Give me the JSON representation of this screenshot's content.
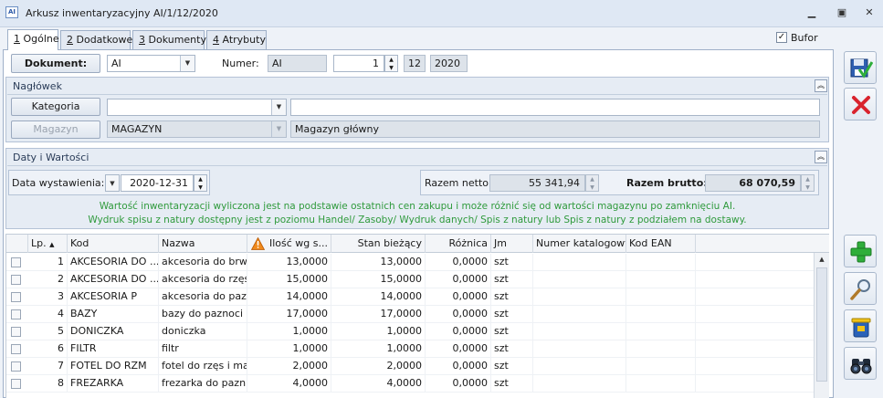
{
  "window": {
    "title": "Arkusz inwentaryzacyjny AI/1/12/2020",
    "app_icon_text": "AI"
  },
  "tabs": [
    {
      "key": "1",
      "label": " Ogólne",
      "active": true
    },
    {
      "key": "2",
      "label": " Dodatkowe",
      "active": false
    },
    {
      "key": "3",
      "label": " Dokumenty",
      "active": false
    },
    {
      "key": "4",
      "label": " Atrybuty",
      "active": false
    }
  ],
  "bufor": {
    "label": "Bufor",
    "checked": true
  },
  "document": {
    "button_label": "Dokument:",
    "type_value": "AI",
    "numer_label": "Numer:",
    "numer_prefix": "AI",
    "numer_value": "1",
    "month": "12",
    "year": "2020"
  },
  "naglowek": {
    "title": "Nagłówek",
    "kategoria_button": "Kategoria",
    "kategoria_value": "",
    "kategoria_desc": "",
    "magazyn_button": "Magazyn",
    "magazyn_value": "MAGAZYN",
    "magazyn_desc": "Magazyn główny"
  },
  "daty": {
    "title": "Daty i Wartości",
    "data_label": "Data wystawienia:",
    "data_value": "2020-12-31",
    "netto_label": "Razem netto:",
    "netto_value": "55 341,94",
    "brutto_label": "Razem brutto:",
    "brutto_value": "68 070,59",
    "info_line1": "Wartość inwentaryzacji wyliczona jest na podstawie ostatnich cen zakupu i może różnić się od wartości magazynu po zamknięciu AI.",
    "info_line2": "Wydruk spisu z natury dostępny jest z poziomu Handel/ Zasoby/ Wydruk danych/ Spis z natury lub Spis z natury z podziałem na dostawy."
  },
  "table": {
    "columns": {
      "lp": "Lp.",
      "kod": "Kod",
      "nazwa": "Nazwa",
      "ilosc": "Ilość wg s...",
      "stan": "Stan bieżący",
      "roznica": "Różnica",
      "jm": "Jm",
      "katalog": "Numer katalogowy",
      "ean": "Kod EAN"
    },
    "rows": [
      {
        "lp": "1",
        "kod": "AKCESORIA DO ...",
        "nazwa": "akcesoria do brw...",
        "ilosc": "13,0000",
        "stan": "13,0000",
        "roznica": "0,0000",
        "jm": "szt"
      },
      {
        "lp": "2",
        "kod": "AKCESORIA DO ...",
        "nazwa": "akcesoria do rzęs",
        "ilosc": "15,0000",
        "stan": "15,0000",
        "roznica": "0,0000",
        "jm": "szt"
      },
      {
        "lp": "3",
        "kod": "AKCESORIA P",
        "nazwa": "akcesoria do paz...",
        "ilosc": "14,0000",
        "stan": "14,0000",
        "roznica": "0,0000",
        "jm": "szt"
      },
      {
        "lp": "4",
        "kod": "BAZY",
        "nazwa": "bazy do paznoci",
        "ilosc": "17,0000",
        "stan": "17,0000",
        "roznica": "0,0000",
        "jm": "szt"
      },
      {
        "lp": "5",
        "kod": "DONICZKA",
        "nazwa": "doniczka",
        "ilosc": "1,0000",
        "stan": "1,0000",
        "roznica": "0,0000",
        "jm": "szt"
      },
      {
        "lp": "6",
        "kod": "FILTR",
        "nazwa": "filtr",
        "ilosc": "1,0000",
        "stan": "1,0000",
        "roznica": "0,0000",
        "jm": "szt"
      },
      {
        "lp": "7",
        "kod": "FOTEL DO RZM",
        "nazwa": "fotel do rzęs i ma...",
        "ilosc": "2,0000",
        "stan": "2,0000",
        "roznica": "0,0000",
        "jm": "szt"
      },
      {
        "lp": "8",
        "kod": "FREZARKA",
        "nazwa": "frezarka do pazn...",
        "ilosc": "4,0000",
        "stan": "4,0000",
        "roznica": "0,0000",
        "jm": "szt"
      }
    ]
  },
  "icons": {
    "save": "save-icon",
    "cancel": "cancel-icon",
    "add": "add-icon",
    "edit": "edit-icon",
    "delete": "delete-icon",
    "search": "binoculars-icon",
    "warning": "warning-icon"
  },
  "colors": {
    "info_text": "#2f9a3c",
    "cancel_red": "#d9232d",
    "add_green": "#2fae3a",
    "warning_orange": "#f08a1c"
  }
}
